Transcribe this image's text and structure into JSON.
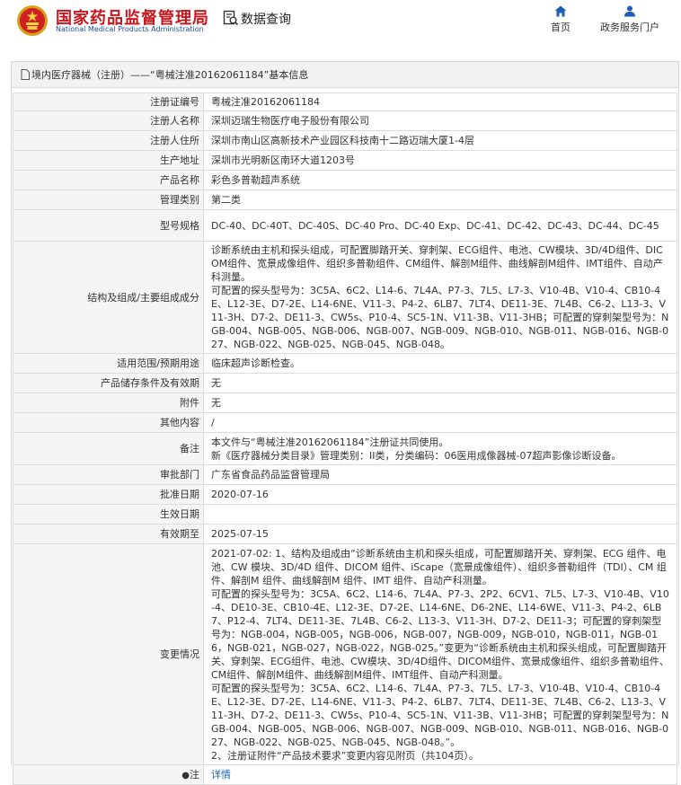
{
  "header": {
    "site_name_cn": "国家药品监督管理局",
    "site_name_en": "National Medical Products Administration",
    "query_label": "数据查询",
    "nav": [
      {
        "label": "首页",
        "icon": "home-icon"
      },
      {
        "label": "政务服务门户",
        "icon": "user-icon"
      }
    ]
  },
  "panel": {
    "title": "境内医疗器械（注册）——“粤械注准20162061184”基本信息"
  },
  "rows": [
    {
      "label": "注册证编号",
      "value": "粤械注准20162061184"
    },
    {
      "label": "注册人名称",
      "value": "深圳迈瑞生物医疗电子股份有限公司"
    },
    {
      "label": "注册人住所",
      "value": "深圳市南山区高新技术产业园区科技南十二路迈瑞大厦1-4层"
    },
    {
      "label": "生产地址",
      "value": "深圳市光明新区南环大道1203号"
    },
    {
      "label": "产品名称",
      "value": "彩色多普勒超声系统"
    },
    {
      "label": "管理类别",
      "value": "第二类"
    },
    {
      "label": "型号规格",
      "value": "DC-40、DC-40T、DC-40S、DC-40 Pro、DC-40 Exp、DC-41、DC-42、DC-43、DC-44、DC-45"
    },
    {
      "label": "结构及组成/主要组成成分",
      "value": "诊断系统由主机和探头组成，可配置脚踏开关、穿刺架、ECG组件、电池、CW模块、3D/4D组件、DICOM组件、宽景成像组件、组织多普勒组件、CM组件、解剖M组件、曲线解剖M组件、IMT组件、自动产科测量。",
      "value2": "可配置的探头型号为：3C5A、6C2、L14-6、7L4A、P7-3、7L5、L7-3、V10-4B、V10-4、CB10-4E、L12-3E、D7-2E、L14-6NE、V11-3、P4-2、6LB7、7LT4、DE11-3E、7L4B、C6-2、L13-3、V11-3H、D7-2、DE11-3、CW5s、P10-4、SC5-1N、V11-3B、V11-3HB；可配置的穿刺架型号为：NGB-004、NGB-005、NGB-006、NGB-007、NGB-009、NGB-010、NGB-011、NGB-016、NGB-027、NGB-022、NGB-025、NGB-045、NGB-048。"
    },
    {
      "label": "适用范围/预期用途",
      "value": "临床超声诊断检查。"
    },
    {
      "label": "产品储存条件及有效期",
      "value": "无"
    },
    {
      "label": "附件",
      "value": "无"
    },
    {
      "label": "其他内容",
      "value": "/"
    },
    {
      "label": "备注",
      "value": "本文件与“粤械注准20162061184”注册证共同使用。",
      "value2": "新《医疗器械分类目录》管理类别：II类，分类编码：06医用成像器械-07超声影像诊断设备。"
    },
    {
      "label": "审批部门",
      "value": "广东省食品药品监督管理局"
    },
    {
      "label": "批准日期",
      "value": "2020-07-16"
    },
    {
      "label": "生效日期",
      "value": ""
    },
    {
      "label": "有效期至",
      "value": "2025-07-15"
    },
    {
      "label": "变更情况",
      "value": "2021-07-02: 1、结构及组成由“诊断系统由主机和探头组成，可配置脚踏开关、穿刺架、ECG 组件、电池、CW 模块、3D/4D 组件、DICOM 组件、iScape（宽景成像组件）、组织多普勒组件（TDI）、CM 组件、解剖M 组件、曲线解剖M 组件、IMT 组件、自动产科测量。",
      "value2": "可配置的探头型号为：3C5A、6C2、L14-6、7L4A、P7-3、2P2、6CV1、7L5、L7-3、V10-4B、V10-4、DE10-3E、CB10-4E、L12-3E、D7-2E、L14-6NE、D6-2NE、L14-6WE、V11-3、P4-2、6LB7、P12-4、7LT4、DE11-3E、7L4B、C6-2、L13-3、V11-3H、D7-2、DE11-3；可配置的穿刺架型号为：NGB-004，NGB-005，NGB-006，NGB-007，NGB-009，NGB-010，NGB-011，NGB-016，NGB-021，NGB-027，NGB-022，NGB-025。”变更为“诊断系统由主机和探头组成，可配置脚踏开关、穿刺架、ECG组件、电池、CW模块、3D/4D组件、DICOM组件、宽景成像组件、组织多普勒组件、CM组件、解剖M组件、曲线解剖M组件、IMT组件、自动产科测量。",
      "value3": "可配置的探头型号为：3C5A、6C2、L14-6、7L4A、P7-3、7L5、L7-3、V10-4B、V10-4、CB10-4E、L12-3E、D7-2E、L14-6NE、V11-3、P4-2、6LB7、7LT4、DE11-3E、7L4B、C6-2、L13-3、V11-3H、D7-2、DE11-3、CW5s、P10-4、SC5-1N、V11-3B、V11-3HB；可配置的穿刺架型号为：NGB-004、NGB-005、NGB-006、NGB-007、NGB-009、NGB-010、NGB-011、NGB-016、NGB-027、NGB-022、NGB-025、NGB-045、NGB-048。”。",
      "value4": "2、注册证附件“产品技术要求”变更内容见附页（共104页）。"
    },
    {
      "label": "注",
      "value": "详情"
    }
  ],
  "colors": {
    "brand_red": "#c8161d",
    "brand_blue": "#1d4f9e",
    "link": "#1a62b9",
    "label_bg": "#f5f5f5"
  }
}
